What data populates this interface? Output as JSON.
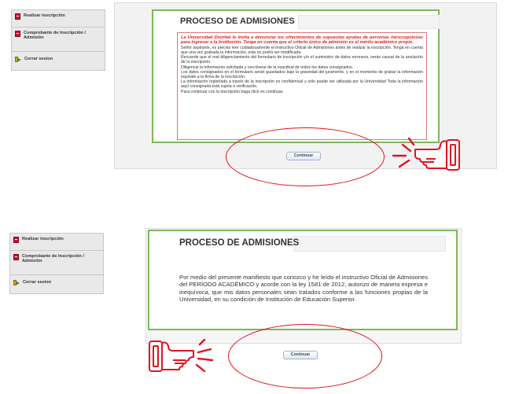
{
  "sidebar": {
    "items": [
      {
        "label": "Realizar inscripción",
        "icon": "pdf-icon"
      },
      {
        "label": "Comprobante de Inscripción / Admisión",
        "icon": "pdf-icon"
      },
      {
        "label": "Cerrar sesion",
        "icon": "exit-icon"
      }
    ]
  },
  "top_panel": {
    "title": "PROCESO DE ADMISIONES",
    "warning": "La Universidad Distrital lo invita a denunciar los ofrecimientos de supuestas ayudas de personas inescrupulosas para ingresar a la Institución. Tenga en cuenta que el criterio único de admisión es el mérito académico propio.",
    "paragraphs": [
      "Señor aspirante, es preciso leer cuidadosamente el instructivo Oficial de Admisiones antes de realizar la inscripción. Tenga en cuenta que una vez grabada la información, esta no podrá ser modificada.",
      "Recuerde que el mal diligenciamiento del formulario de inscripción y/o el suministro de datos erroneos, serán causal de la anulación de la inscripción.",
      "Diligencie la información solicitada y cerciórese de la exactitud de todos los datos consignados.",
      "Los datos consignados en el formulario serán guardados bajo la gravedad del juramento, y en el momento de grabar la información equivale a la firma de la inscripción.",
      "La información registrada a través de la inscripción es confidencial y sólo puede ser utilizada por la Universidad Toda la información aquí consignada está sujeta a verificación.",
      "Para continuar con la inscripción haga click en continuar."
    ],
    "button_label": "Continuar"
  },
  "bottom_panel": {
    "title": "PROCESO DE ADMISIONES",
    "declaration": "Por medio del presente manifiesto que conozco y he leído el instructivo Oficial de Admisiones del                         PERÍODO ACADÉMICO                 y acorde con la ley 1581 de 2012, autorizo de manera expresa e inequívoca, que mis datos personales sean tratados conforme a las funciones propias de la Universidad, en su condición de Institución de Educación Superior.",
    "button_label": "Continuar"
  },
  "colors": {
    "panel_border": "#7cb857",
    "warning_text": "#e02020",
    "highlight_oval": "#e0141e"
  }
}
